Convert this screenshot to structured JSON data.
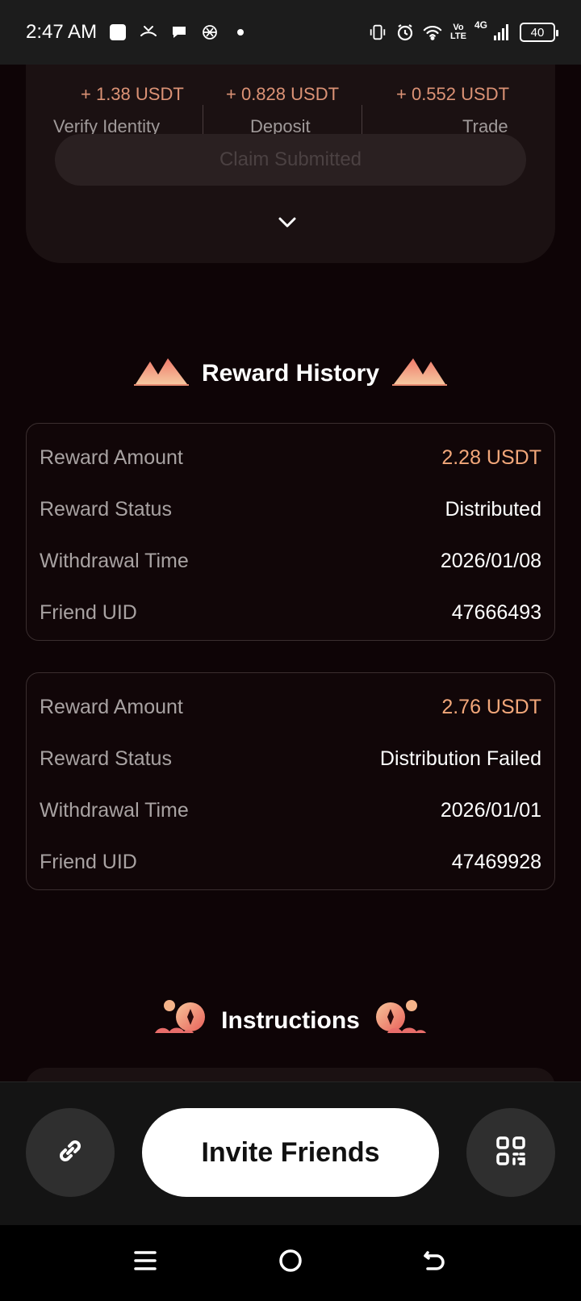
{
  "status_bar": {
    "time": "2:47 AM",
    "battery": "40",
    "network": "4G",
    "volte": "Vo\nLTE"
  },
  "tasks": {
    "items": [
      {
        "amount": "+ 1.38 USDT",
        "label": "Verify Identity"
      },
      {
        "amount": "+ 0.828 USDT",
        "label": "Deposit"
      },
      {
        "amount": "+ 0.552 USDT",
        "label": "Trade"
      }
    ],
    "claim_label": "Claim Submitted"
  },
  "reward_history": {
    "title": "Reward History",
    "records": [
      {
        "rows": [
          {
            "key": "Reward Amount",
            "value": "2.28 USDT"
          },
          {
            "key": "Reward Status",
            "value": "Distributed"
          },
          {
            "key": "Withdrawal Time",
            "value": "2026/01/08"
          },
          {
            "key": "Friend UID",
            "value": "47666493"
          }
        ]
      },
      {
        "rows": [
          {
            "key": "Reward Amount",
            "value": "2.76 USDT"
          },
          {
            "key": "Reward Status",
            "value": "Distribution Failed"
          },
          {
            "key": "Withdrawal Time",
            "value": "2026/01/01"
          },
          {
            "key": "Friend UID",
            "value": "47469928"
          }
        ]
      }
    ]
  },
  "instructions": {
    "title": "Instructions"
  },
  "action_bar": {
    "invite_label": "Invite Friends"
  },
  "colors": {
    "accent_amount": "#f2a77a",
    "background": "#0e0406"
  }
}
